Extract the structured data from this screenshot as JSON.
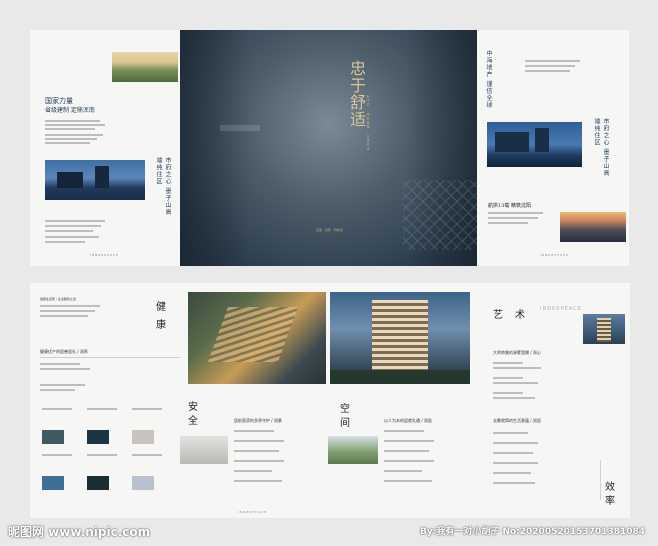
{
  "cover": {
    "title": "忠于舒适",
    "subline": "新中式 · 纯粹典雅 · 高级生活",
    "bottom": "贝加 · 尚府 · 府井府"
  },
  "panel_left": {
    "headline1": "国家力量",
    "headline2": "省级建制 定鼎浑南",
    "vertical_title": "市府之心 墨子山高端纯住区",
    "brand": "INNERPEACE"
  },
  "panel_right": {
    "vertical_title1": "中海地产 谨信全球",
    "vertical_title2": "市府之心 墨子山高端纯住区",
    "caption": "航拱13载 精筑沈阳",
    "brand": "INNERPEACE"
  },
  "spread": {
    "intro_label": "健康生活家 / 生活服务之道",
    "health_char1": "健",
    "health_char2": "康",
    "health_sub": "健康优产的居善居礼 / 润养",
    "safety_char1": "安",
    "safety_char2": "全",
    "safety_sub": "居前直滨的多界守护 / 润景",
    "space_char1": "空",
    "space_char2": "间",
    "space_sub": "以人为本的居就礼遇 / 润居",
    "art_char1": "艺",
    "art_char2": "术",
    "art_sub": "大师审美的源蒙宽赠 / 润心",
    "art_sub2": "去繁就简的生活意蕴 / 润居",
    "eff_char1": "效",
    "eff_char2": "率",
    "brand_top": "INNERPEACE",
    "brand_bottom": "INNERPEACE"
  },
  "watermark": {
    "left": "昵图网 www.nipic.com",
    "right": "By:我有一对小胡子 No:20200520153701381084"
  },
  "colors": {
    "cover_dark": "#2c3d4c",
    "accent": "#1f3a5c",
    "gold": "#c9b07a"
  }
}
